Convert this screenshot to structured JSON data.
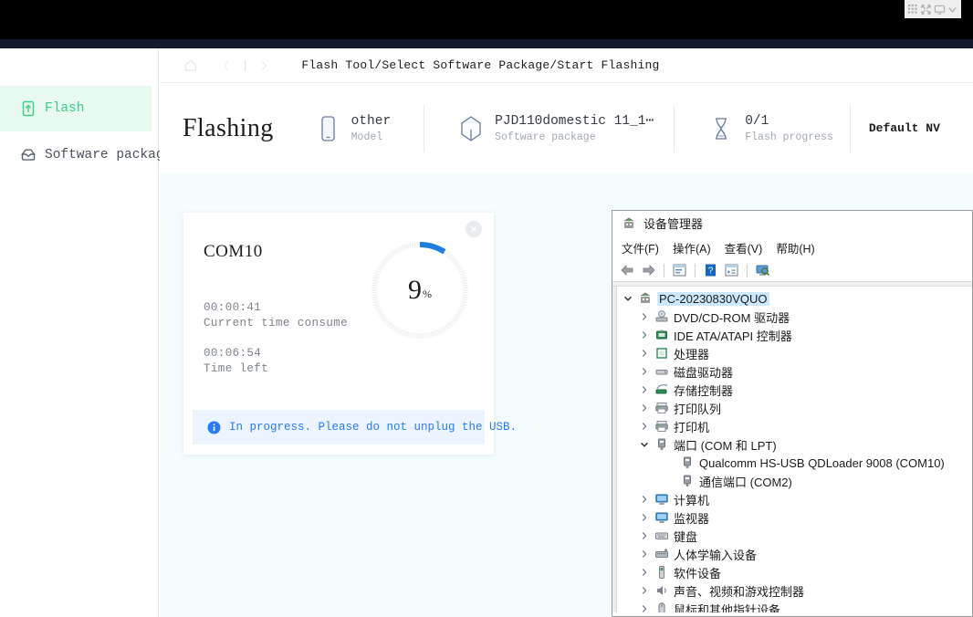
{
  "capture_toolbar": {
    "icons": [
      "grid-icon",
      "expand-icon",
      "monitor-icon",
      "chevron-down-icon"
    ]
  },
  "sidebar": {
    "items": [
      {
        "label": "Flash",
        "icon": "upload-box-icon",
        "active": true
      },
      {
        "label": "Software packag⋯",
        "icon": "inbox-icon",
        "active": false
      }
    ]
  },
  "breadcrumb": {
    "home_icon": "home-icon",
    "back_icon": "chevron-left-icon",
    "divider": "|",
    "forward_icon": "chevron-right-icon",
    "path": "Flash Tool/Select Software Package/Start Flashing"
  },
  "header": {
    "title": "Flashing",
    "meta": [
      {
        "icon": "phone-icon",
        "value": "other",
        "label": "Model"
      },
      {
        "icon": "package-cube-icon",
        "value": "PJD110domestic 11_1⋯",
        "label": "Software package"
      },
      {
        "icon": "hourglass-icon",
        "value": "0/1",
        "label": "Flash progress"
      }
    ],
    "nv_label": "Default NV"
  },
  "progress_card": {
    "port": "COM10",
    "close_icon": "close-circle-icon",
    "percent_value": "9",
    "percent_symbol": "%",
    "percent_number": 9,
    "time_used": {
      "value": "00:00:41",
      "label": "Current time consume"
    },
    "time_left": {
      "value": "00:06:54",
      "label": "Time left"
    },
    "banner": {
      "icon": "info-circle-icon",
      "text": "In progress. Please do not unplug the USB."
    },
    "accent_color": "#1f7fe0",
    "track_color": "#ededed"
  },
  "device_manager": {
    "title": "设备管理器",
    "title_icon": "device-manager-icon",
    "menu": [
      "文件(F)",
      "操作(A)",
      "查看(V)",
      "帮助(H)"
    ],
    "toolbar_icons": [
      "back-arrow-icon",
      "forward-arrow-icon",
      "properties-icon",
      "help-icon",
      "show-hidden-icon",
      "scan-hardware-icon"
    ],
    "tree": [
      {
        "level": 0,
        "chevron": "down",
        "icon": "computer-icon",
        "label": "PC-20230830VQUO",
        "selected": true
      },
      {
        "level": 1,
        "chevron": "right",
        "icon": "dvd-icon",
        "label": "DVD/CD-ROM 驱动器",
        "selected": false
      },
      {
        "level": 1,
        "chevron": "right",
        "icon": "ide-icon",
        "label": "IDE ATA/ATAPI 控制器",
        "selected": false
      },
      {
        "level": 1,
        "chevron": "right",
        "icon": "processor-icon",
        "label": "处理器",
        "selected": false
      },
      {
        "level": 1,
        "chevron": "right",
        "icon": "disk-icon",
        "label": "磁盘驱动器",
        "selected": false
      },
      {
        "level": 1,
        "chevron": "right",
        "icon": "storage-controller-icon",
        "label": "存储控制器",
        "selected": false
      },
      {
        "level": 1,
        "chevron": "right",
        "icon": "printer-queue-icon",
        "label": "打印队列",
        "selected": false
      },
      {
        "level": 1,
        "chevron": "right",
        "icon": "printer-icon",
        "label": "打印机",
        "selected": false
      },
      {
        "level": 1,
        "chevron": "down",
        "icon": "port-icon",
        "label": "端口 (COM 和 LPT)",
        "selected": false
      },
      {
        "level": 2,
        "chevron": "none",
        "icon": "port-icon",
        "label": "Qualcomm HS-USB QDLoader 9008 (COM10)",
        "selected": false
      },
      {
        "level": 2,
        "chevron": "none",
        "icon": "port-icon",
        "label": "通信端口 (COM2)",
        "selected": false
      },
      {
        "level": 1,
        "chevron": "right",
        "icon": "monitor-icon",
        "label": "计算机",
        "selected": false
      },
      {
        "level": 1,
        "chevron": "right",
        "icon": "monitor-icon",
        "label": "监视器",
        "selected": false
      },
      {
        "level": 1,
        "chevron": "right",
        "icon": "keyboard-icon",
        "label": "键盘",
        "selected": false
      },
      {
        "level": 1,
        "chevron": "right",
        "icon": "hid-icon",
        "label": "人体学输入设备",
        "selected": false
      },
      {
        "level": 1,
        "chevron": "right",
        "icon": "software-device-icon",
        "label": "软件设备",
        "selected": false
      },
      {
        "level": 1,
        "chevron": "right",
        "icon": "sound-icon",
        "label": "声音、视频和游戏控制器",
        "selected": false
      },
      {
        "level": 1,
        "chevron": "right",
        "icon": "mouse-icon",
        "label": "鼠标和其他指针设备",
        "selected": false
      }
    ]
  }
}
